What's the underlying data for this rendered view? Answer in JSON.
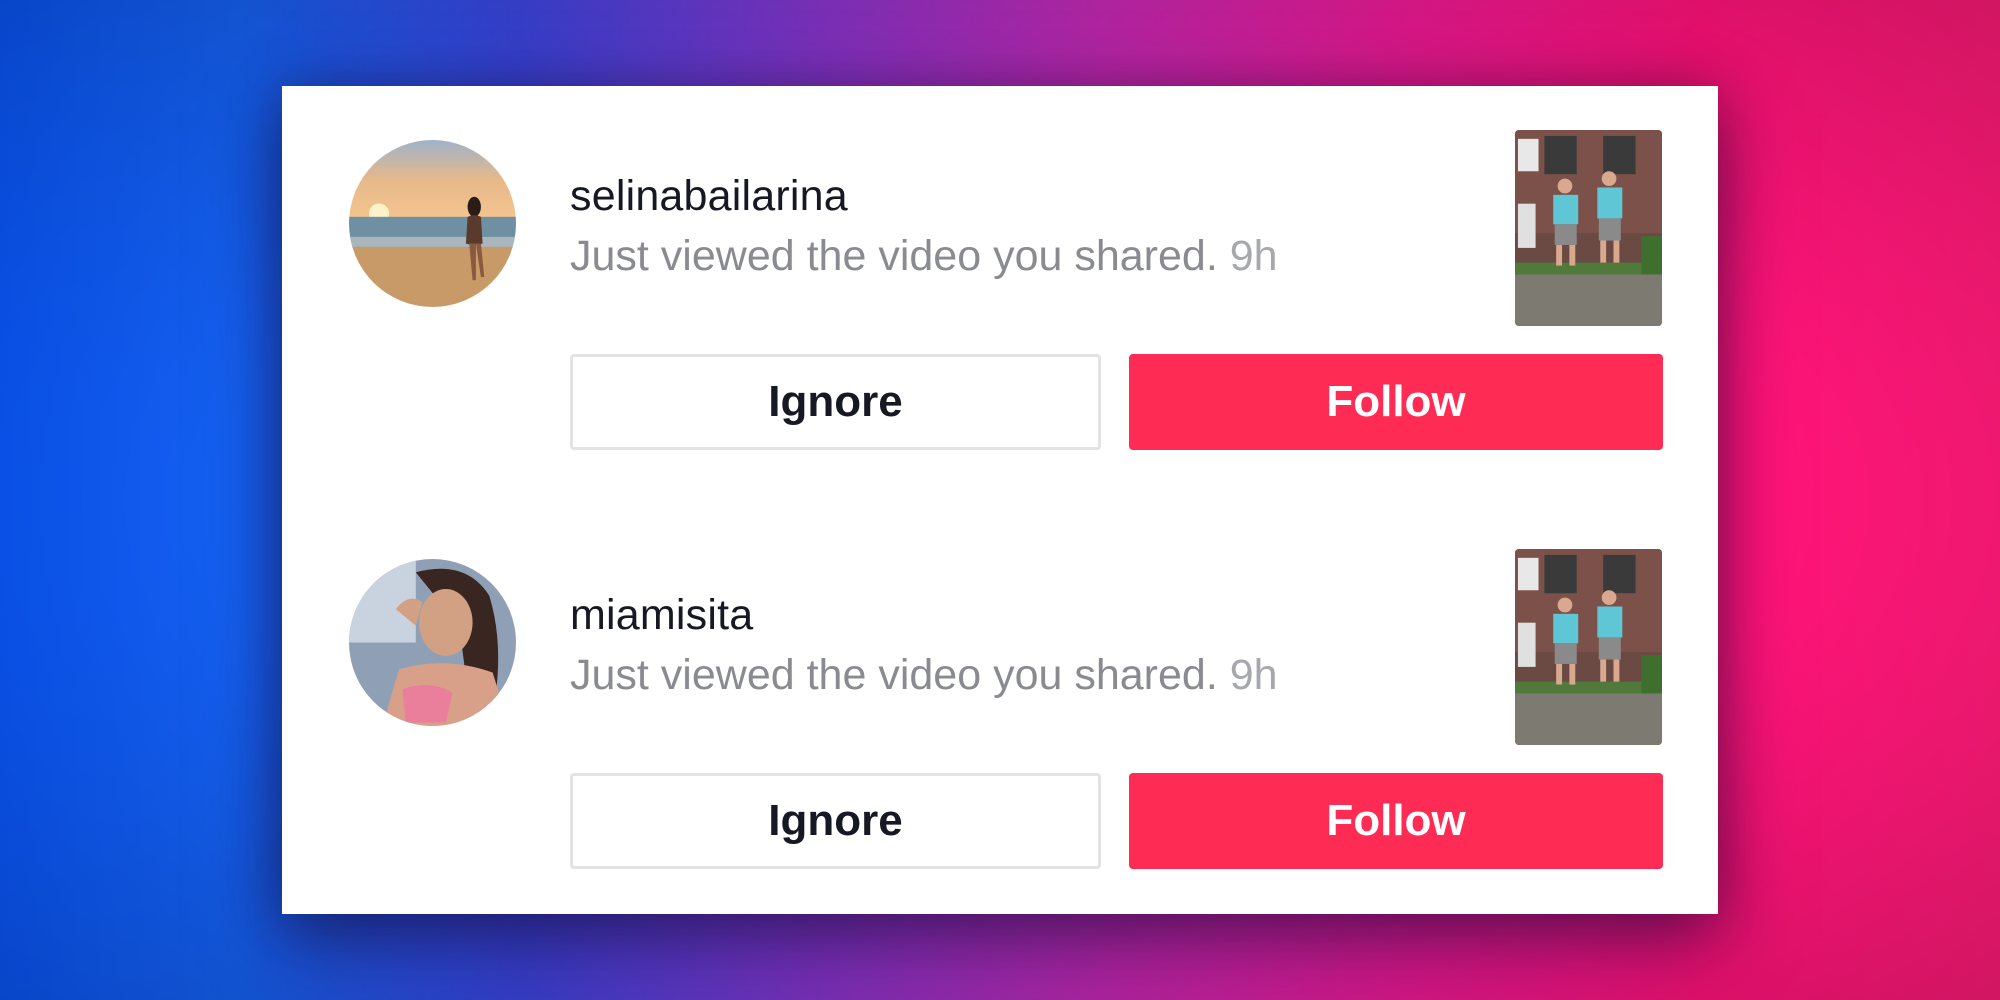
{
  "notifications": [
    {
      "username": "selinabailarina",
      "message": "Just viewed the video you shared.",
      "time": "9h",
      "ignore_label": "Ignore",
      "follow_label": "Follow"
    },
    {
      "username": "miamisita",
      "message": "Just viewed the video you shared.",
      "time": "9h",
      "ignore_label": "Ignore",
      "follow_label": "Follow"
    }
  ],
  "colors": {
    "follow_button": "#fe2c55",
    "username_text": "#161823",
    "message_text": "#8a8b91",
    "ignore_border": "#e3e3e4"
  }
}
